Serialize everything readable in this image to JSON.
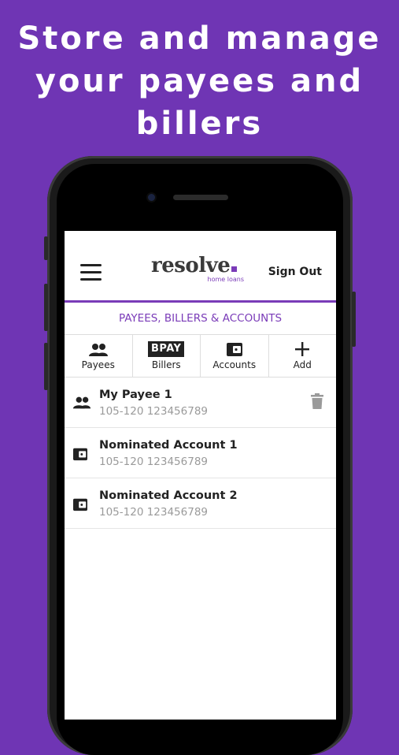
{
  "headline": {
    "line1": "Store and manage",
    "line2": "your payees and",
    "line3": "billers"
  },
  "appbar": {
    "logo_word": "resolve",
    "logo_sub": "home loans",
    "sign_out": "Sign Out"
  },
  "section_title": "PAYEES, BILLERS & ACCOUNTS",
  "tabs": [
    {
      "label": "Payees",
      "icon": "people-icon"
    },
    {
      "label": "Billers",
      "icon": "bpay-icon",
      "badge": "BPAY"
    },
    {
      "label": "Accounts",
      "icon": "wallet-icon"
    },
    {
      "label": "Add",
      "icon": "plus-icon"
    }
  ],
  "items": [
    {
      "name": "My Payee 1",
      "account": "105-120 123456789",
      "icon": "people-icon",
      "deletable": true
    },
    {
      "name": "Nominated Account 1",
      "account": "105-120 123456789",
      "icon": "wallet-icon"
    },
    {
      "name": "Nominated Account 2",
      "account": "105-120 123456789",
      "icon": "wallet-icon"
    }
  ],
  "colors": {
    "background": "#6f35b4",
    "accent": "#7a3bb8"
  }
}
